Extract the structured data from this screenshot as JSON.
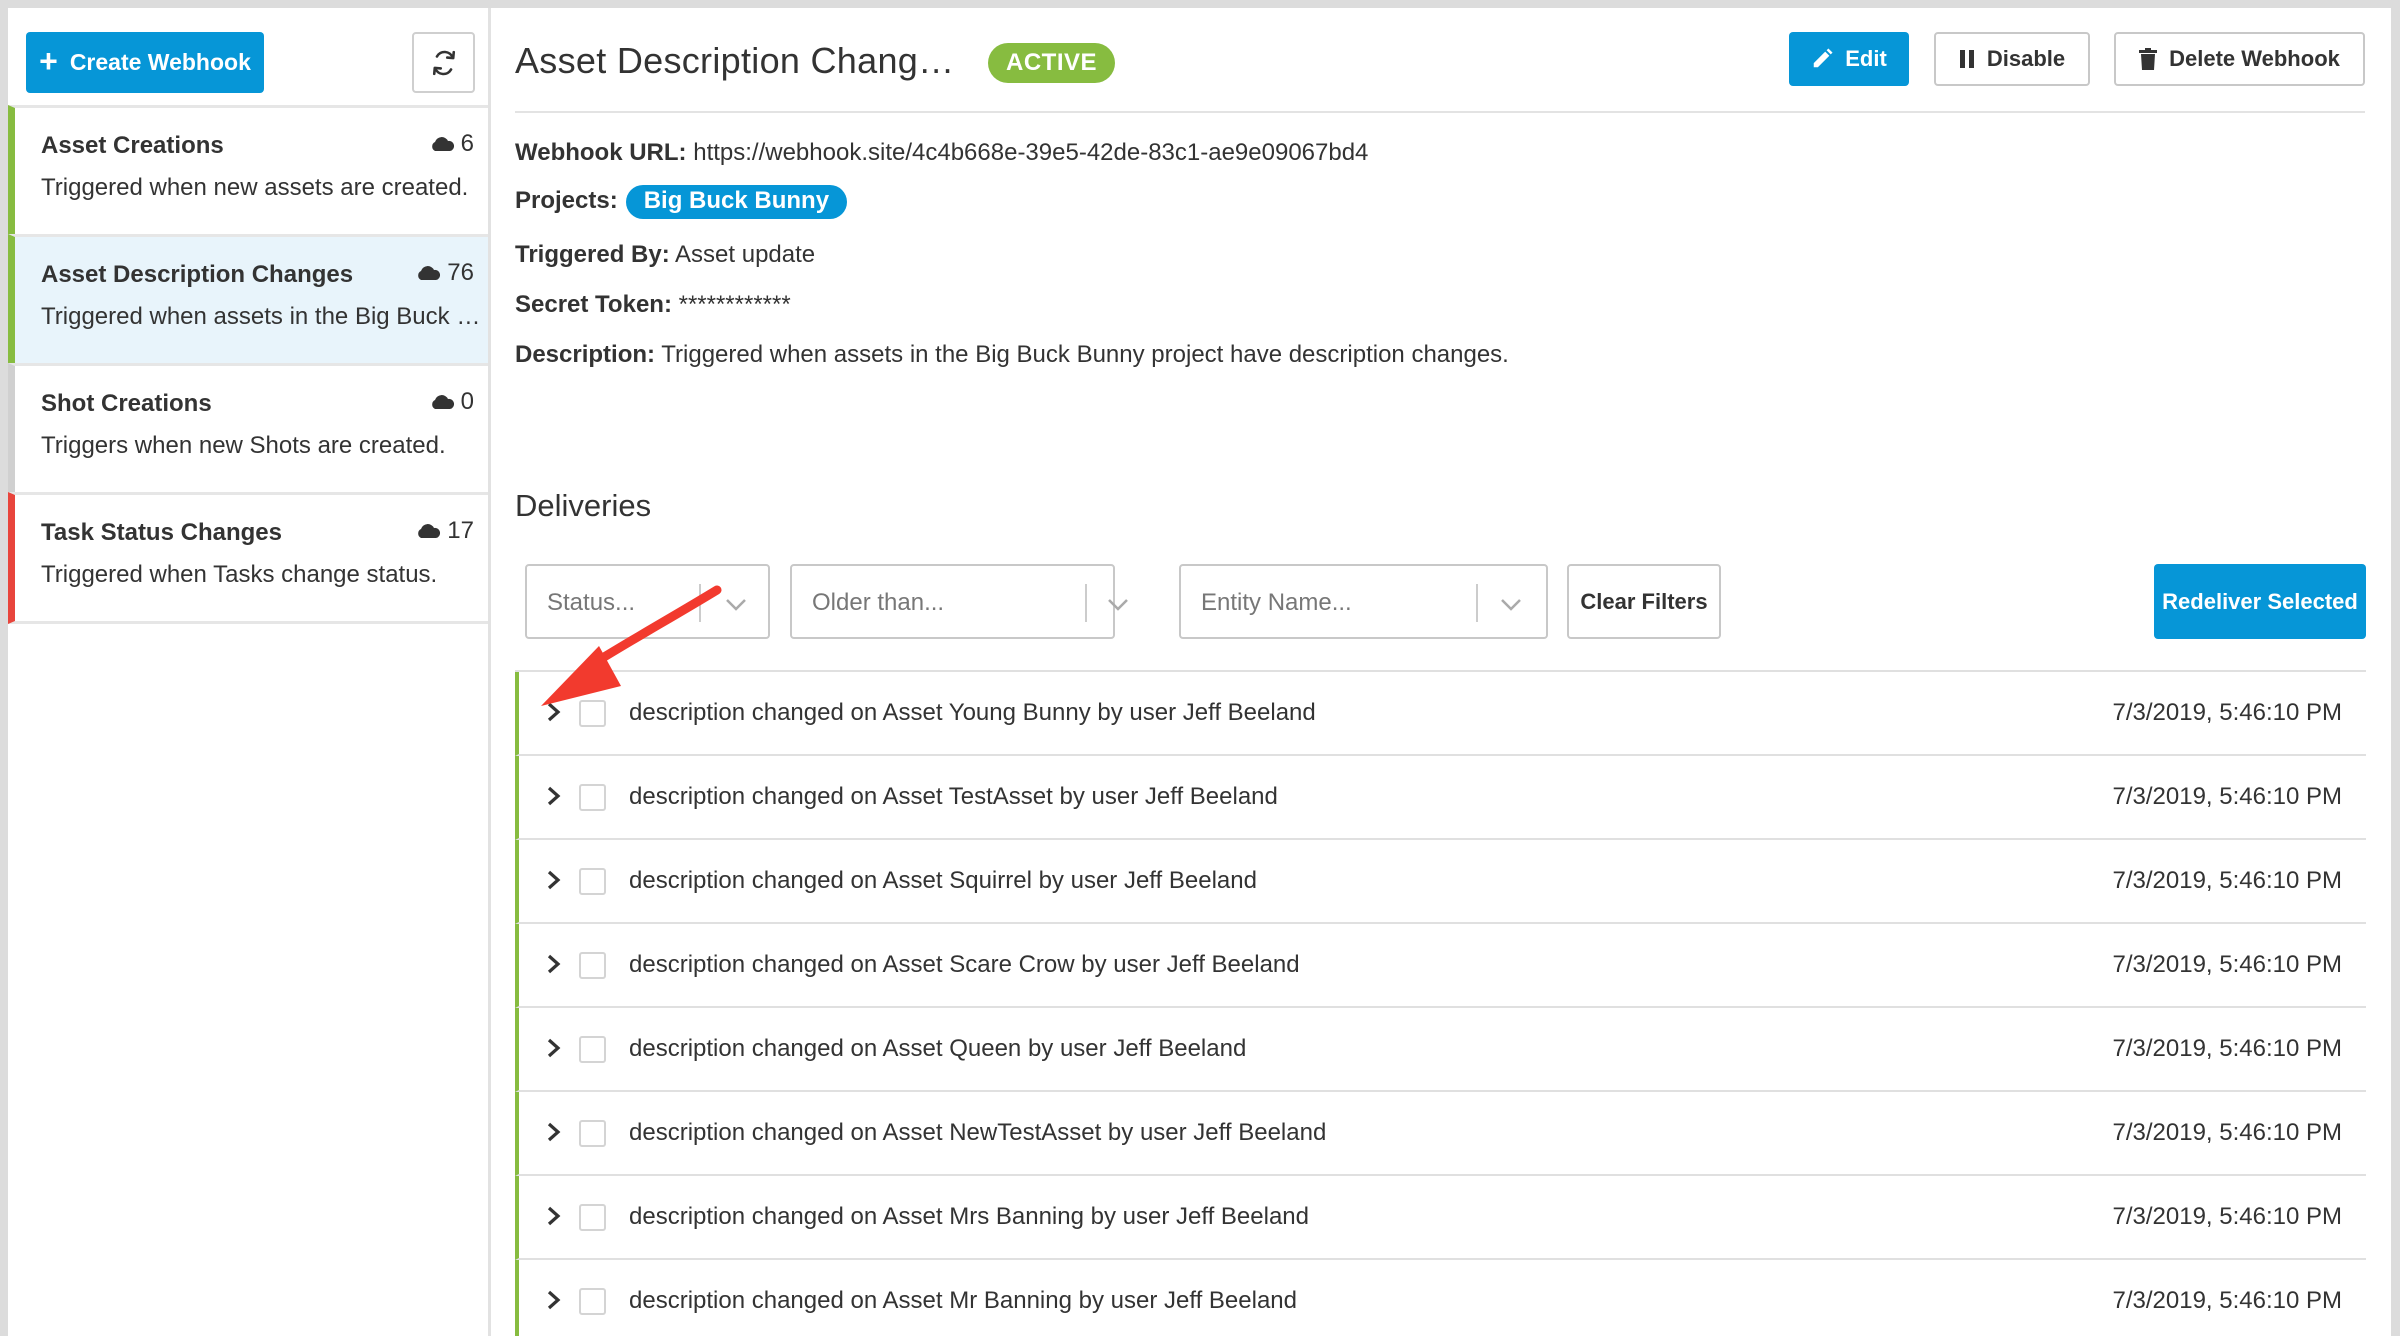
{
  "sidebar": {
    "create_label": "Create Webhook",
    "items": [
      {
        "name": "Asset Creations",
        "description": "Triggered when new assets are created.",
        "count": "6",
        "status_color": "#87bc40"
      },
      {
        "name": "Asset Description Changes",
        "description": "Triggered when assets in the Big Buck Bunny project have description changes.",
        "count": "76",
        "status_color": "#87bc40"
      },
      {
        "name": "Shot Creations",
        "description": "Triggers when new Shots are created.",
        "count": "0",
        "status_color": "#d0d0d0"
      },
      {
        "name": "Task Status Changes",
        "description": "Triggered when Tasks change status.",
        "count": "17",
        "status_color": "#e8453c"
      }
    ]
  },
  "header": {
    "title": "Asset Description Chang…",
    "status": "ACTIVE",
    "edit_label": "Edit",
    "disable_label": "Disable",
    "delete_label": "Delete Webhook"
  },
  "details": {
    "url_label": "Webhook URL:",
    "url": "https://webhook.site/4c4b668e-39e5-42de-83c1-ae9e09067bd4",
    "projects_label": "Projects:",
    "project": "Big Buck Bunny",
    "triggered_label": "Triggered By:",
    "triggered": "Asset update",
    "token_label": "Secret Token:",
    "token": "************",
    "description_label": "Description:",
    "description": "Triggered when assets in the Big Buck Bunny project have description changes."
  },
  "deliveries": {
    "heading": "Deliveries",
    "filters": {
      "status_placeholder": "Status...",
      "older_placeholder": "Older than...",
      "entity_placeholder": "Entity Name..."
    },
    "clear_label": "Clear Filters",
    "redeliver_label": "Redeliver Selected",
    "rows": [
      {
        "message": "description changed on Asset Young Bunny by user Jeff Beeland",
        "time": "7/3/2019, 5:46:10 PM"
      },
      {
        "message": "description changed on Asset TestAsset by user Jeff Beeland",
        "time": "7/3/2019, 5:46:10 PM"
      },
      {
        "message": "description changed on Asset Squirrel by user Jeff Beeland",
        "time": "7/3/2019, 5:46:10 PM"
      },
      {
        "message": "description changed on Asset Scare Crow by user Jeff Beeland",
        "time": "7/3/2019, 5:46:10 PM"
      },
      {
        "message": "description changed on Asset Queen by user Jeff Beeland",
        "time": "7/3/2019, 5:46:10 PM"
      },
      {
        "message": "description changed on Asset NewTestAsset by user Jeff Beeland",
        "time": "7/3/2019, 5:46:10 PM"
      },
      {
        "message": "description changed on Asset Mrs Banning by user Jeff Beeland",
        "time": "7/3/2019, 5:46:10 PM"
      },
      {
        "message": "description changed on Asset Mr Banning by user Jeff Beeland",
        "time": "7/3/2019, 5:46:10 PM"
      }
    ]
  },
  "colors": {
    "accent": "#0696d7",
    "active": "#87bc40",
    "error": "#e8453c",
    "annotation": "#f23a2e"
  }
}
